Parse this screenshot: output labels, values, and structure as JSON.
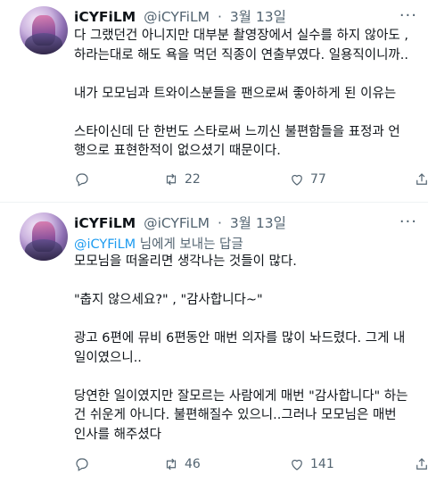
{
  "tweets": [
    {
      "author": {
        "name": "iCYFiLM",
        "handle": "@iCYFiLM",
        "date": "3월 13일"
      },
      "reply_to": null,
      "paragraphs": [
        "다 그랬던건 아니지만 대부분 촬영장에서 실수를 하지 않아도 ,\n하라는대로 해도 욕을 먹던 직종이 연출부였다. 일용직이니까..",
        "내가 모모님과 트와이스분들을 팬으로써 좋아하게 된 이유는",
        "스타이신데 단 한번도 스타로써 느끼신 불편함들을 표정과 언\n행으로 표현한적이 없으셨기 때문이다."
      ],
      "stats": {
        "retweets": "22",
        "likes": "77"
      }
    },
    {
      "author": {
        "name": "iCYFiLM",
        "handle": "@iCYFiLM",
        "date": "3월 13일"
      },
      "reply_to": {
        "handle": "@iCYFiLM",
        "suffix": " 님에게 보내는 답글"
      },
      "paragraphs": [
        "모모님을 떠올리면 생각나는 것들이 많다.",
        "\"춥지 않으세요?\" , \"감사합니다~\"",
        "광고 6편에 뮤비 6편동안 매번 의자를 많이 놔드렸다. 그게 내\n일이였으니..",
        "당연한 일이였지만 잘모르는 사람에게 매번 \"감사합니다\" 하는\n건 쉬운게 아니다. 불편해질수 있으니..그러나 모모님은 매번\n인사를 해주셨다"
      ],
      "stats": {
        "retweets": "46",
        "likes": "141"
      }
    }
  ],
  "separator": "·",
  "icons": [
    "reply-icon",
    "retweet-icon",
    "like-icon",
    "share-icon",
    "more-icon"
  ],
  "colors": {
    "link": "#1d9bf0",
    "muted": "#536471",
    "text": "#0f1419"
  }
}
